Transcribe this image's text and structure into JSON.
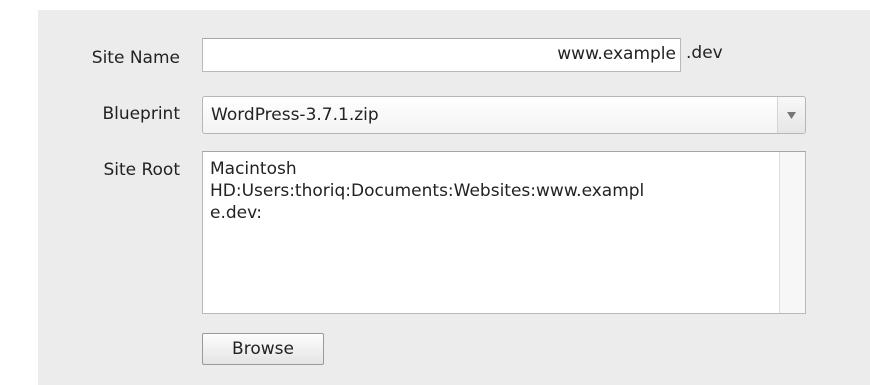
{
  "form": {
    "site_name": {
      "label": "Site Name",
      "value": "www.example",
      "suffix": ".dev"
    },
    "blueprint": {
      "label": "Blueprint",
      "selected": "WordPress-3.7.1.zip",
      "arrow_icon": "dropdown-arrow-icon"
    },
    "site_root": {
      "label": "Site Root",
      "value": "Macintosh\nHD:Users:thoriq:Documents:Websites:www.exampl\ne.dev:"
    },
    "browse_label": "Browse"
  },
  "colors": {
    "panel_background": "#ececec",
    "field_border": "#b9b9b9",
    "text": "#222222"
  }
}
